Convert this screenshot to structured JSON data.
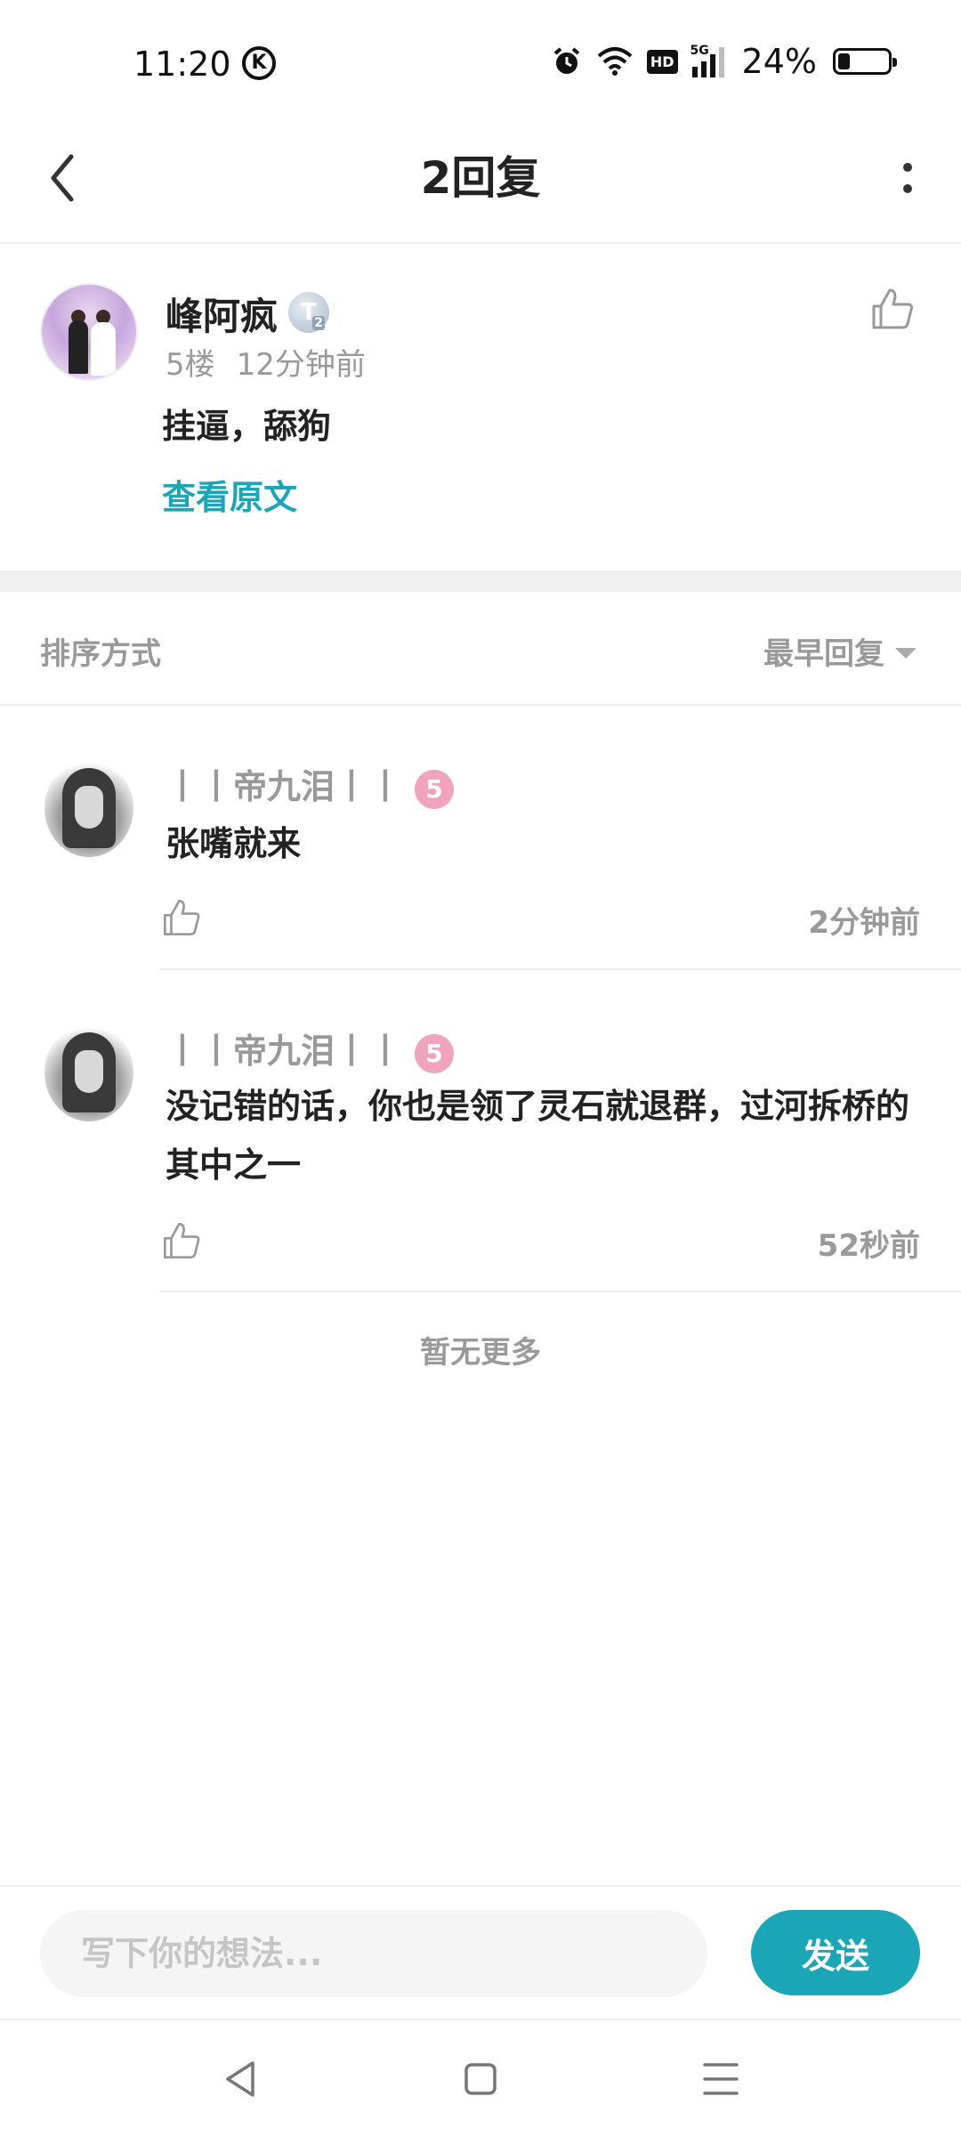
{
  "status_bar": {
    "time": "11:20",
    "k_icon": "K",
    "hd": "HD",
    "network": "5G",
    "battery_percent": "24%",
    "battery_level": 0.24
  },
  "header": {
    "title": "2回复",
    "back_icon": "chevron-left-icon",
    "more_icon": "more-vertical-icon"
  },
  "main_post": {
    "author": "峰阿疯",
    "level_badge": "T",
    "level_sub": "2",
    "floor": "5楼",
    "time": "12分钟前",
    "content": "挂逼，舔狗",
    "view_original": "查看原文"
  },
  "sort": {
    "label": "排序方式",
    "selected": "最早回复"
  },
  "replies": [
    {
      "author": "丨丨帝九泪丨丨",
      "badge": "5",
      "content": "张嘴就来",
      "time": "2分钟前"
    },
    {
      "author": "丨丨帝九泪丨丨",
      "badge": "5",
      "content": "没记错的话，你也是领了灵石就退群，过河拆桥的其中之一",
      "time": "52秒前"
    }
  ],
  "no_more": "暂无更多",
  "input": {
    "placeholder": "写下你的想法...",
    "send_label": "发送"
  },
  "colors": {
    "accent": "#1aa6b7",
    "muted": "#999999",
    "badge_pink": "#f0a3bd"
  }
}
